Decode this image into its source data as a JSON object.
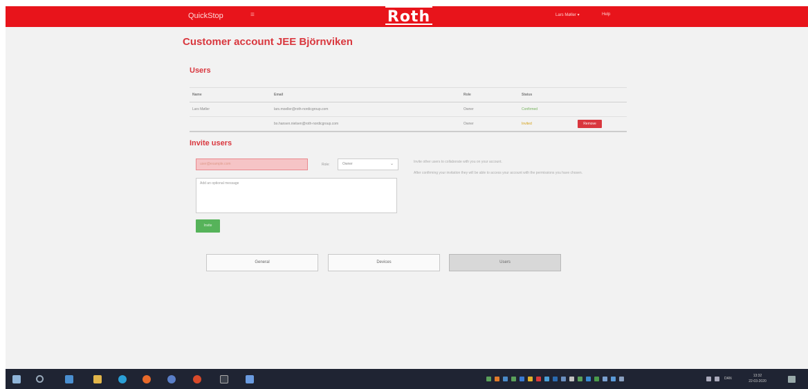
{
  "header": {
    "brand": "QuickStop",
    "brand_caret": "≡",
    "logo": "Roth",
    "user_menu": "Lars Møller ▾",
    "help": "Help"
  },
  "page_title": "Customer account JEE Björnviken",
  "users": {
    "title": "Users",
    "columns": [
      "Name",
      "Email",
      "Role",
      "Status"
    ],
    "rows": [
      {
        "name": "Lars Møller",
        "email": "lars.moeller@roth-nordicgroup.com",
        "role": "Owner",
        "status": "Confirmed"
      },
      {
        "name": "",
        "email": "bo.hansen.nielsen@roth-nordicgroup.com",
        "role": "Owner",
        "status": "Invited",
        "action": "Remove"
      }
    ]
  },
  "invite": {
    "title": "Invite users",
    "email_placeholder": "user@example.com",
    "role_label": "Role:",
    "role_value": "Owner",
    "message_placeholder": "Add an optional message",
    "help_1": "Invite other users to collaborate with you on your account.",
    "help_2": "After confirming your invitation they will be able to access your account with the permissions you have chosen.",
    "button": "Invite"
  },
  "tabs": [
    "General",
    "Devices",
    "Users"
  ],
  "active_tab": "Users",
  "taskbar": {
    "language": "DAN",
    "time": "13:32",
    "date": "22-03-2020"
  },
  "colors": {
    "accent": "#e8141b",
    "title": "#d9373e",
    "success": "#56b35a",
    "danger": "#d9373e"
  }
}
